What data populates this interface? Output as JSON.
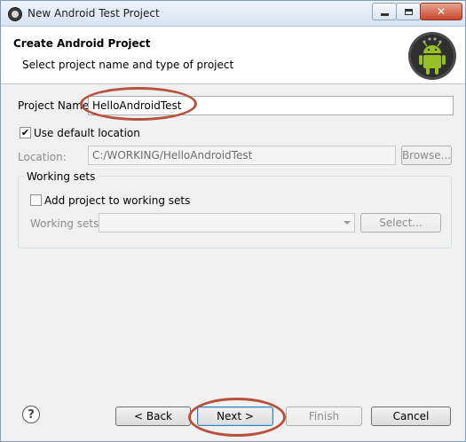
{
  "window": {
    "title": "New Android Test Project"
  },
  "banner": {
    "title": "Create Android Project",
    "subtitle": "Select project name and type of project"
  },
  "form": {
    "project_name_label": "Project Name:",
    "project_name_value": "HelloAndroidTest",
    "use_default_location_label": "Use default location",
    "use_default_location_checked": true,
    "location_label": "Location:",
    "location_value": "C:/WORKING/HelloAndroidTest",
    "browse_label": "Browse..."
  },
  "working_sets": {
    "group_title": "Working sets",
    "add_to_working_sets_label": "Add project to working sets",
    "add_to_working_sets_checked": false,
    "working_sets_label": "Working sets:",
    "working_sets_value": "",
    "select_label": "Select..."
  },
  "footer": {
    "back_label": "< Back",
    "next_label": "Next >",
    "finish_label": "Finish",
    "cancel_label": "Cancel"
  },
  "icons": {
    "app": "eclipse-icon",
    "banner": "android-logo-icon",
    "help": "help-icon"
  },
  "colors": {
    "annotation": "#b5523f",
    "android_green": "#97c024"
  }
}
